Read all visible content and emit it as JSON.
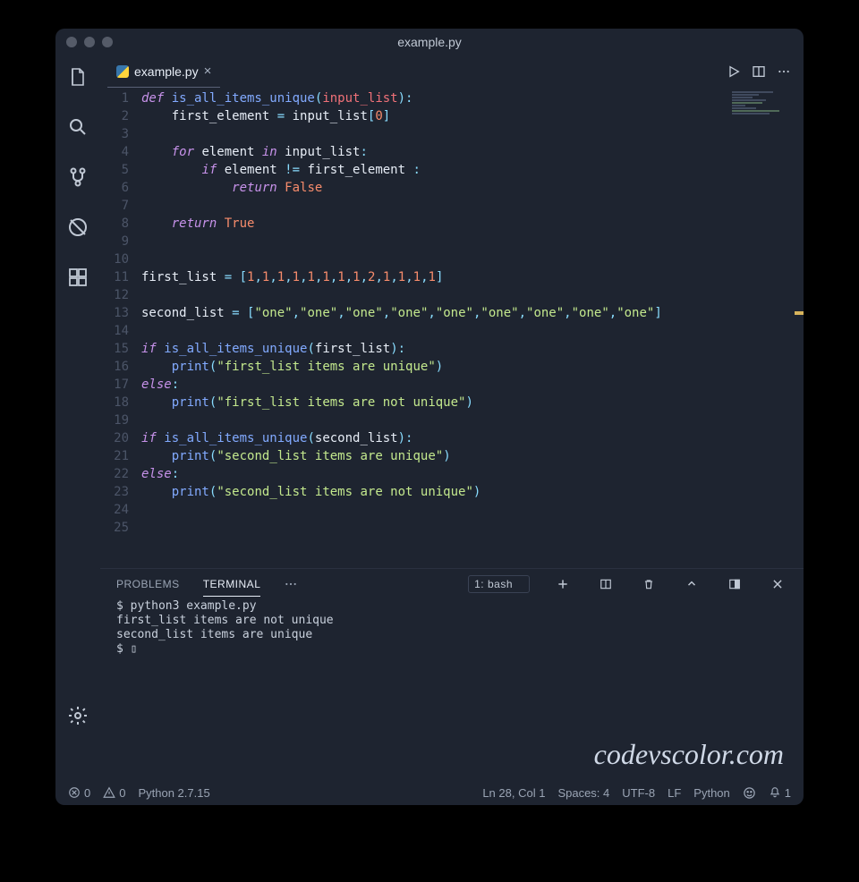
{
  "window": {
    "title": "example.py"
  },
  "tab": {
    "filename": "example.py"
  },
  "code": {
    "line_numbers": [
      "1",
      "2",
      "3",
      "4",
      "5",
      "6",
      "7",
      "8",
      "9",
      "10",
      "11",
      "12",
      "13",
      "14",
      "15",
      "16",
      "17",
      "18",
      "19",
      "20",
      "21",
      "22",
      "23",
      "24",
      "25"
    ],
    "lines": [
      [
        [
          "kw",
          "def "
        ],
        [
          "fn",
          "is_all_items_unique"
        ],
        [
          "punct",
          "("
        ],
        [
          "param",
          "input_list"
        ],
        [
          "punct",
          "):"
        ]
      ],
      [
        [
          "",
          "    "
        ],
        [
          "ident",
          "first_element"
        ],
        [
          "op",
          " = "
        ],
        [
          "ident",
          "input_list"
        ],
        [
          "punct",
          "["
        ],
        [
          "num",
          "0"
        ],
        [
          "punct",
          "]"
        ]
      ],
      [],
      [
        [
          "",
          "    "
        ],
        [
          "kw",
          "for "
        ],
        [
          "ident",
          "element"
        ],
        [
          "kw",
          " in "
        ],
        [
          "ident",
          "input_list"
        ],
        [
          "punct",
          ":"
        ]
      ],
      [
        [
          "",
          "        "
        ],
        [
          "kw",
          "if "
        ],
        [
          "ident",
          "element"
        ],
        [
          "op",
          " != "
        ],
        [
          "ident",
          "first_element"
        ],
        [
          "punct",
          " :"
        ]
      ],
      [
        [
          "",
          "            "
        ],
        [
          "kw",
          "return "
        ],
        [
          "bool",
          "False"
        ]
      ],
      [],
      [
        [
          "",
          "    "
        ],
        [
          "kw",
          "return "
        ],
        [
          "bool",
          "True"
        ]
      ],
      [],
      [],
      [
        [
          "ident",
          "first_list"
        ],
        [
          "op",
          " = "
        ],
        [
          "punct",
          "["
        ],
        [
          "num",
          "1"
        ],
        [
          "punct",
          ","
        ],
        [
          "num",
          "1"
        ],
        [
          "punct",
          ","
        ],
        [
          "num",
          "1"
        ],
        [
          "punct",
          ","
        ],
        [
          "num",
          "1"
        ],
        [
          "punct",
          ","
        ],
        [
          "num",
          "1"
        ],
        [
          "punct",
          ","
        ],
        [
          "num",
          "1"
        ],
        [
          "punct",
          ","
        ],
        [
          "num",
          "1"
        ],
        [
          "punct",
          ","
        ],
        [
          "num",
          "1"
        ],
        [
          "punct",
          ","
        ],
        [
          "num",
          "2"
        ],
        [
          "punct",
          ","
        ],
        [
          "num",
          "1"
        ],
        [
          "punct",
          ","
        ],
        [
          "num",
          "1"
        ],
        [
          "punct",
          ","
        ],
        [
          "num",
          "1"
        ],
        [
          "punct",
          ","
        ],
        [
          "num",
          "1"
        ],
        [
          "punct",
          "]"
        ]
      ],
      [],
      [
        [
          "ident",
          "second_list"
        ],
        [
          "op",
          " = "
        ],
        [
          "punct",
          "["
        ],
        [
          "str",
          "\"one\""
        ],
        [
          "punct",
          ","
        ],
        [
          "str",
          "\"one\""
        ],
        [
          "punct",
          ","
        ],
        [
          "str",
          "\"one\""
        ],
        [
          "punct",
          ","
        ],
        [
          "str",
          "\"one\""
        ],
        [
          "punct",
          ","
        ],
        [
          "str",
          "\"one\""
        ],
        [
          "punct",
          ","
        ],
        [
          "str",
          "\"one\""
        ],
        [
          "punct",
          ","
        ],
        [
          "str",
          "\"one\""
        ],
        [
          "punct",
          ","
        ],
        [
          "str",
          "\"one\""
        ],
        [
          "punct",
          ","
        ],
        [
          "str",
          "\"one\""
        ],
        [
          "punct",
          "]"
        ]
      ],
      [],
      [
        [
          "kw",
          "if "
        ],
        [
          "fn",
          "is_all_items_unique"
        ],
        [
          "punct",
          "("
        ],
        [
          "ident",
          "first_list"
        ],
        [
          "punct",
          "):"
        ]
      ],
      [
        [
          "",
          "    "
        ],
        [
          "fn",
          "print"
        ],
        [
          "punct",
          "("
        ],
        [
          "str",
          "\"first_list items are unique\""
        ],
        [
          "punct",
          ")"
        ]
      ],
      [
        [
          "kw",
          "else"
        ],
        [
          "punct",
          ":"
        ]
      ],
      [
        [
          "",
          "    "
        ],
        [
          "fn",
          "print"
        ],
        [
          "punct",
          "("
        ],
        [
          "str",
          "\"first_list items are not unique\""
        ],
        [
          "punct",
          ")"
        ]
      ],
      [],
      [
        [
          "kw",
          "if "
        ],
        [
          "fn",
          "is_all_items_unique"
        ],
        [
          "punct",
          "("
        ],
        [
          "ident",
          "second_list"
        ],
        [
          "punct",
          "):"
        ]
      ],
      [
        [
          "",
          "    "
        ],
        [
          "fn",
          "print"
        ],
        [
          "punct",
          "("
        ],
        [
          "str",
          "\"second_list items are unique\""
        ],
        [
          "punct",
          ")"
        ]
      ],
      [
        [
          "kw",
          "else"
        ],
        [
          "punct",
          ":"
        ]
      ],
      [
        [
          "",
          "    "
        ],
        [
          "fn",
          "print"
        ],
        [
          "punct",
          "("
        ],
        [
          "str",
          "\"second_list items are not unique\""
        ],
        [
          "punct",
          ")"
        ]
      ],
      [],
      []
    ]
  },
  "panel": {
    "tabs": {
      "problems": "PROBLEMS",
      "terminal": "TERMINAL"
    },
    "terminal_selector": "1: bash",
    "output": "$ python3 example.py\nfirst_list items are not unique\nsecond_list items are unique\n$ ▯"
  },
  "status": {
    "errors": "0",
    "warnings": "0",
    "python": "Python 2.7.15",
    "cursor": "Ln 28, Col 1",
    "spaces": "Spaces: 4",
    "encoding": "UTF-8",
    "eol": "LF",
    "language": "Python",
    "bell": "1"
  },
  "brand": "codevscolor.com"
}
